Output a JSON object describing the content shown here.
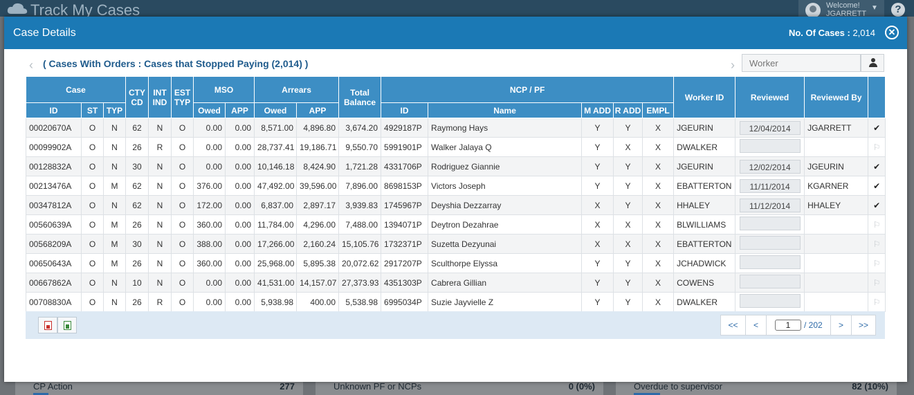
{
  "app": {
    "title": "Track My Cases",
    "welcome": "Welcome!",
    "username": "JGARRETT",
    "help": "?"
  },
  "background_panels": [
    {
      "label": "CP Action",
      "value": "277"
    },
    {
      "label": "Unknown PF or NCPs",
      "value": "0 (0%)"
    },
    {
      "label": "Overdue to supervisor",
      "value": "82 (10%)"
    }
  ],
  "modal": {
    "title": "Case Details",
    "count_label": "No. Of Cases :",
    "count_value": "2,014",
    "subtitle": "( Cases With Orders : Cases that Stopped Paying (2,014) )",
    "worker_placeholder": "Worker"
  },
  "table": {
    "group_headers": {
      "case": "Case",
      "cty": "CTY CD",
      "int": "INT IND",
      "est": "EST TYP",
      "mso": "MSO",
      "arrears": "Arrears",
      "total": "Total Balance",
      "ncp": "NCP / PF",
      "worker": "Worker ID",
      "reviewed": "Reviewed",
      "reviewed_by": "Reviewed By"
    },
    "sub_headers": {
      "id": "ID",
      "st": "ST",
      "typ": "TYP",
      "mso_owed": "Owed",
      "mso_app": "APP",
      "arr_owed": "Owed",
      "arr_app": "APP",
      "ncp_id": "ID",
      "name": "Name",
      "madd": "M ADD",
      "radd": "R ADD",
      "empl": "EMPL"
    },
    "rows": [
      {
        "id": "00020670A",
        "st": "O",
        "typ": "N",
        "cty": "62",
        "int": "N",
        "est": "O",
        "mso_owed": "0.00",
        "mso_app": "0.00",
        "arr_owed": "8,571.00",
        "arr_app": "4,896.80",
        "total": "3,674.20",
        "ncp_id": "4929187P",
        "name": "Raymong Hays",
        "madd": "Y",
        "radd": "Y",
        "empl": "X",
        "worker": "JGEURIN",
        "reviewed": "12/04/2014",
        "reviewed_by": "JGARRETT",
        "status": "✔"
      },
      {
        "id": "00099902A",
        "st": "O",
        "typ": "N",
        "cty": "26",
        "int": "R",
        "est": "O",
        "mso_owed": "0.00",
        "mso_app": "0.00",
        "arr_owed": "28,737.41",
        "arr_app": "19,186.71",
        "total": "9,550.70",
        "ncp_id": "5991901P",
        "name": "Walker Jalaya Q",
        "madd": "Y",
        "radd": "X",
        "empl": "X",
        "worker": "DWALKER",
        "reviewed": "",
        "reviewed_by": "",
        "status": "⚐"
      },
      {
        "id": "00128832A",
        "st": "O",
        "typ": "N",
        "cty": "30",
        "int": "N",
        "est": "O",
        "mso_owed": "0.00",
        "mso_app": "0.00",
        "arr_owed": "10,146.18",
        "arr_app": "8,424.90",
        "total": "1,721.28",
        "ncp_id": "4331706P",
        "name": "Rodriguez Giannie",
        "madd": "Y",
        "radd": "Y",
        "empl": "X",
        "worker": "JGEURIN",
        "reviewed": "12/02/2014",
        "reviewed_by": "JGEURIN",
        "status": "✔"
      },
      {
        "id": "00213476A",
        "st": "O",
        "typ": "M",
        "cty": "62",
        "int": "N",
        "est": "O",
        "mso_owed": "376.00",
        "mso_app": "0.00",
        "arr_owed": "47,492.00",
        "arr_app": "39,596.00",
        "total": "7,896.00",
        "ncp_id": "8698153P",
        "name": "Victors Joseph",
        "madd": "Y",
        "radd": "Y",
        "empl": "X",
        "worker": "EBATTERTON",
        "reviewed": "11/11/2014",
        "reviewed_by": "KGARNER",
        "status": "✔"
      },
      {
        "id": "00347812A",
        "st": "O",
        "typ": "N",
        "cty": "62",
        "int": "N",
        "est": "O",
        "mso_owed": "172.00",
        "mso_app": "0.00",
        "arr_owed": "6,837.00",
        "arr_app": "2,897.17",
        "total": "3,939.83",
        "ncp_id": "1745967P",
        "name": "Deyshia Dezzarray",
        "madd": "X",
        "radd": "Y",
        "empl": "X",
        "worker": "HHALEY",
        "reviewed": "11/12/2014",
        "reviewed_by": "HHALEY",
        "status": "✔"
      },
      {
        "id": "00560639A",
        "st": "O",
        "typ": "M",
        "cty": "26",
        "int": "N",
        "est": "O",
        "mso_owed": "360.00",
        "mso_app": "0.00",
        "arr_owed": "11,784.00",
        "arr_app": "4,296.00",
        "total": "7,488.00",
        "ncp_id": "1394071P",
        "name": "Deytron Dezahrae",
        "madd": "X",
        "radd": "X",
        "empl": "X",
        "worker": "BLWILLIAMS",
        "reviewed": "",
        "reviewed_by": "",
        "status": "⚐"
      },
      {
        "id": "00568209A",
        "st": "O",
        "typ": "M",
        "cty": "30",
        "int": "N",
        "est": "O",
        "mso_owed": "388.00",
        "mso_app": "0.00",
        "arr_owed": "17,266.00",
        "arr_app": "2,160.24",
        "total": "15,105.76",
        "ncp_id": "1732371P",
        "name": "Suzetta Dezyunai",
        "madd": "X",
        "radd": "X",
        "empl": "X",
        "worker": "EBATTERTON",
        "reviewed": "",
        "reviewed_by": "",
        "status": "⚐"
      },
      {
        "id": "00650643A",
        "st": "O",
        "typ": "M",
        "cty": "26",
        "int": "N",
        "est": "O",
        "mso_owed": "360.00",
        "mso_app": "0.00",
        "arr_owed": "25,968.00",
        "arr_app": "5,895.38",
        "total": "20,072.62",
        "ncp_id": "2917207P",
        "name": "Sculthorpe Elyssa",
        "madd": "Y",
        "radd": "Y",
        "empl": "X",
        "worker": "JCHADWICK",
        "reviewed": "",
        "reviewed_by": "",
        "status": "⚐"
      },
      {
        "id": "00667862A",
        "st": "O",
        "typ": "N",
        "cty": "10",
        "int": "N",
        "est": "O",
        "mso_owed": "0.00",
        "mso_app": "0.00",
        "arr_owed": "41,531.00",
        "arr_app": "14,157.07",
        "total": "27,373.93",
        "ncp_id": "4351303P",
        "name": "Cabrera Gillian",
        "madd": "Y",
        "radd": "Y",
        "empl": "X",
        "worker": "COWENS",
        "reviewed": "",
        "reviewed_by": "",
        "status": "⚐"
      },
      {
        "id": "00708830A",
        "st": "O",
        "typ": "N",
        "cty": "26",
        "int": "R",
        "est": "O",
        "mso_owed": "0.00",
        "mso_app": "0.00",
        "arr_owed": "5,938.98",
        "arr_app": "400.00",
        "total": "5,538.98",
        "ncp_id": "6995034P",
        "name": "Suzie Jayvielle Z",
        "madd": "Y",
        "radd": "Y",
        "empl": "X",
        "worker": "DWALKER",
        "reviewed": "",
        "reviewed_by": "",
        "status": "⚐"
      }
    ]
  },
  "pagination": {
    "first": "<<",
    "prev": "<",
    "current_page": "1",
    "total_pages": "/ 202",
    "next": ">",
    "last": ">>"
  },
  "icons": {
    "pdf": "pdf-icon",
    "excel": "excel-icon",
    "close": "close-icon",
    "user": "user-icon"
  },
  "colors": {
    "header_blue": "#1b79b5",
    "table_header": "#3d8ec4",
    "yes": "#2b8a2b",
    "no": "#d23030"
  }
}
